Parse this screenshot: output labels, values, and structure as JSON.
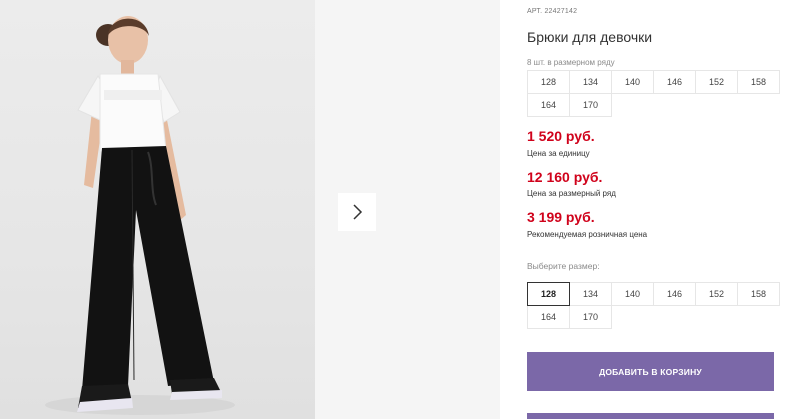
{
  "gallery": {
    "next_arrow_icon": "chevron-right-icon"
  },
  "product": {
    "article_label": "АРТ.",
    "article": "22427142",
    "title": "Брюки для девочки",
    "pack_note": "8 шт. в размерном ряду",
    "pack_sizes": [
      "128",
      "134",
      "140",
      "146",
      "152",
      "158",
      "164",
      "170"
    ],
    "prices": [
      {
        "value": "1 520 руб.",
        "label": "Цена за единицу"
      },
      {
        "value": "12 160 руб.",
        "label": "Цена за размерный ряд"
      },
      {
        "value": "3 199 руб.",
        "label": "Рекомендуемая розничная цена"
      }
    ],
    "choose_size_label": "Выберите размер:",
    "size_options": [
      "128",
      "134",
      "140",
      "146",
      "152",
      "158",
      "164",
      "170"
    ],
    "selected_size": "128",
    "add_to_cart_label": "ДОБАВИТЬ В КОРЗИНУ"
  },
  "colors": {
    "price": "#d0021b",
    "button": "#7b68a8"
  }
}
